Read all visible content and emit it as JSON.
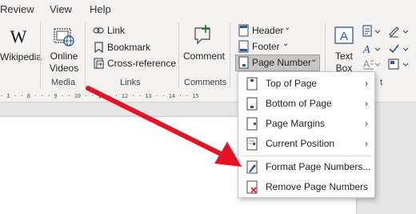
{
  "menu_tabs": [
    "Review",
    "View",
    "Help"
  ],
  "ribbon": {
    "wikipedia_label": "Wikipedia",
    "online_videos_line1": "Online",
    "online_videos_line2": "Videos",
    "link_label": "Link",
    "bookmark_label": "Bookmark",
    "cross_reference_label": "Cross-reference",
    "comment_label": "Comment",
    "header_label": "Header",
    "footer_label": "Footer",
    "page_number_label": "Page Number",
    "text_box_line1": "Text",
    "text_box_line2": "Box"
  },
  "groups": {
    "media": "Media",
    "links": "Links",
    "comments": "Comments",
    "text_tail": "t"
  },
  "ruler_text": "· 1 · · 8 · · · 9 · · 10 · · 11 · · 12 · · 13 · · 14 · · 15",
  "dropdown": {
    "items": [
      {
        "label": "Top of Page",
        "has_submenu": true,
        "icon": "top-of-page-icon"
      },
      {
        "label": "Bottom of Page",
        "has_submenu": true,
        "icon": "bottom-of-page-icon"
      },
      {
        "label": "Page Margins",
        "has_submenu": true,
        "icon": "page-margins-icon"
      },
      {
        "label": "Current Position",
        "has_submenu": true,
        "icon": "current-position-icon"
      },
      {
        "label": "Format Page Numbers...",
        "has_submenu": false,
        "icon": "format-page-numbers-icon"
      },
      {
        "label": "Remove Page Numbers",
        "has_submenu": false,
        "icon": "remove-page-numbers-icon"
      }
    ],
    "submenu_glyph": "›"
  },
  "dropdown_caret": "⌄",
  "colors": {
    "ribbon_bg": "#f3f2f1",
    "accent_blue": "#2b579a",
    "annotation_red": "#e81123"
  }
}
